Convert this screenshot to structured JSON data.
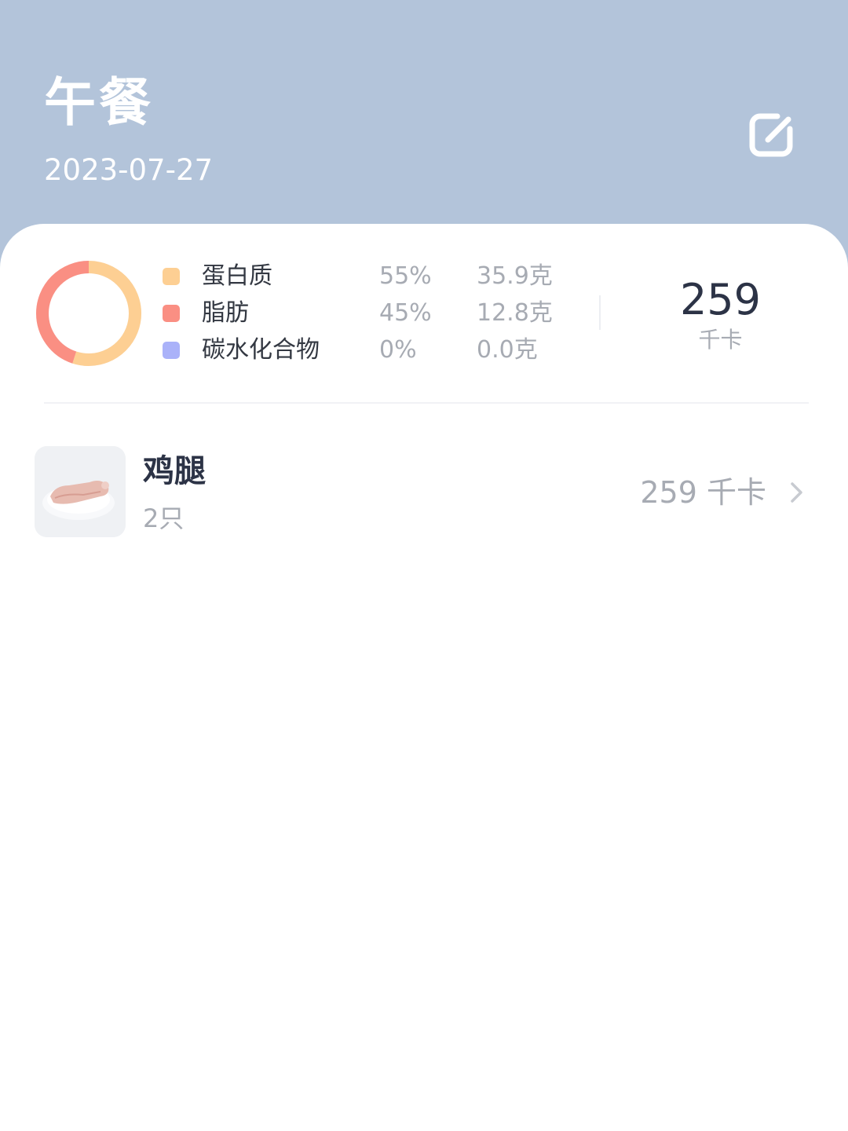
{
  "header": {
    "title": "午餐",
    "date": "2023-07-27",
    "edit_icon": "edit-icon"
  },
  "summary": {
    "nutrients": [
      {
        "name": "蛋白质",
        "percent": "55%",
        "amount": "35.9克",
        "color": "#fdcf93",
        "share": 0.55
      },
      {
        "name": "脂肪",
        "percent": "45%",
        "amount": "12.8克",
        "color": "#fa8f83",
        "share": 0.45
      },
      {
        "name": "碳水化合物",
        "percent": "0%",
        "amount": "0.0克",
        "color": "#aab2f9",
        "share": 0.0
      }
    ],
    "total_kcal": "259",
    "total_unit": "千卡"
  },
  "foods": [
    {
      "name": "鸡腿",
      "quantity": "2只",
      "kcal": "259 千卡",
      "image_icon": "chicken-leg-photo"
    }
  ],
  "colors": {
    "header_bg": "#b3c4da",
    "card_bg": "#ffffff",
    "primary_text": "#2c3346",
    "secondary_text": "#a7abb3"
  }
}
